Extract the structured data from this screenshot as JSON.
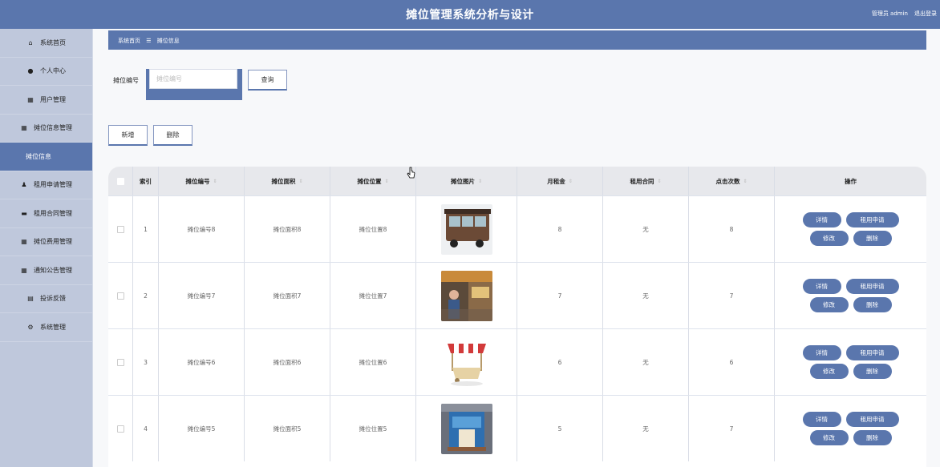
{
  "header": {
    "title": "摊位管理系统分析与设计",
    "user": "管理员 admin",
    "logout": "退出登录"
  },
  "sidebar": {
    "items": [
      {
        "label": "系统首页",
        "icon": "home-icon"
      },
      {
        "label": "个人中心",
        "icon": "user-icon"
      },
      {
        "label": "用户管理",
        "icon": "grid-icon"
      },
      {
        "label": "摊位信息管理",
        "icon": "grid-icon"
      },
      {
        "label": "摊位信息",
        "icon": ""
      },
      {
        "label": "租用申请管理",
        "icon": "person-icon"
      },
      {
        "label": "租用合同管理",
        "icon": "chat-icon"
      },
      {
        "label": "摊位费用管理",
        "icon": "grid-icon"
      },
      {
        "label": "通知公告管理",
        "icon": "grid-icon"
      },
      {
        "label": "投诉反馈",
        "icon": "chart-icon"
      },
      {
        "label": "系统管理",
        "icon": "gear-icon"
      }
    ]
  },
  "breadcrumb": {
    "home": "系统首页",
    "sep": "☰",
    "current": "摊位信息"
  },
  "search": {
    "label": "摊位编号",
    "placeholder": "摊位编号",
    "value": "",
    "button": "查询"
  },
  "actions": {
    "add": "新增",
    "delete": "删除"
  },
  "table": {
    "columns": [
      "",
      "索引",
      "摊位编号",
      "摊位面积",
      "摊位位置",
      "摊位图片",
      "月租金",
      "租用合同",
      "点击次数",
      "操作"
    ],
    "rows": [
      {
        "index": "1",
        "code": "摊位编号8",
        "area": "摊位面积8",
        "location": "摊位位置8",
        "image": "food-cart-photo",
        "rent": "8",
        "contract": "无",
        "clicks": "8"
      },
      {
        "index": "2",
        "code": "摊位编号7",
        "area": "摊位面积7",
        "location": "摊位位置7",
        "image": "market-stall-photo",
        "rent": "7",
        "contract": "无",
        "clicks": "7"
      },
      {
        "index": "3",
        "code": "摊位编号6",
        "area": "摊位面积6",
        "location": "摊位位置6",
        "image": "striped-cart-photo",
        "rent": "6",
        "contract": "无",
        "clicks": "6"
      },
      {
        "index": "4",
        "code": "摊位编号5",
        "area": "摊位面积5",
        "location": "摊位位置5",
        "image": "kiosk-photo",
        "rent": "5",
        "contract": "无",
        "clicks": "7"
      }
    ],
    "row_actions": {
      "detail": "详情",
      "apply": "租用申请",
      "edit": "修改",
      "delete": "删除"
    }
  },
  "colors": {
    "primary": "#5a76ad",
    "sidebar": "#bfc8dc"
  }
}
